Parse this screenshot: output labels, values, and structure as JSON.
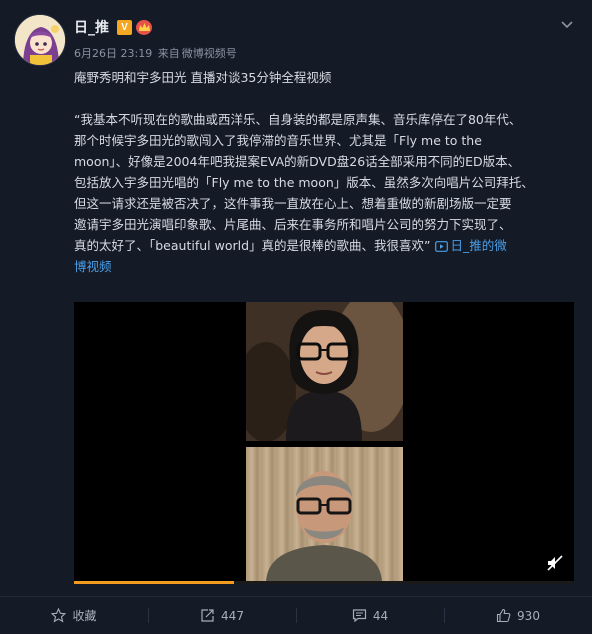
{
  "author": {
    "name": "日_推",
    "avatar_icon": "anime-girl-avatar",
    "badges": [
      "V",
      "crown"
    ]
  },
  "meta": {
    "date": "6月26日 23:19",
    "source_prefix": "来自",
    "source": "微博视频号"
  },
  "post": {
    "headline": "庵野秀明和宇多田光 直播对谈35分钟全程视频",
    "quote_lines": [
      "“我基本不听现在的歌曲或西洋乐、自身装的都是原声集、音乐库停在了80年代、",
      "那个时候宇多田光的歌闯入了我停滞的音乐世界、尤其是「Fly me to the",
      "moon」、好像是2004年吧我提案EVA的新DVD盘26话全部采用不同的ED版本、",
      "包括放入宇多田光唱的「Fly me to the moon」版本、虽然多次向唱片公司拜托、",
      "但这一请求还是被否决了，这件事我一直放在心上、想着重做的新剧场版一定要",
      "邀请宇多田光演唱印象歌、片尾曲、后来在事务所和唱片公司的努力下实现了、",
      "真的太好了、「beautiful world」真的是很棒的歌曲、我很喜欢”"
    ],
    "video_link_label_1": "日_推的微",
    "video_link_label_2": "博视频"
  },
  "video": {
    "progress_fraction": 0.32,
    "accent_color": "#f29b1e"
  },
  "actions": {
    "favorite_label": "收藏",
    "repost_count": "447",
    "comment_count": "44",
    "like_count": "930"
  },
  "colors": {
    "background": "#141a26",
    "link": "#4a9fe8",
    "text": "#d6dbe3",
    "muted": "#8a93a3"
  }
}
